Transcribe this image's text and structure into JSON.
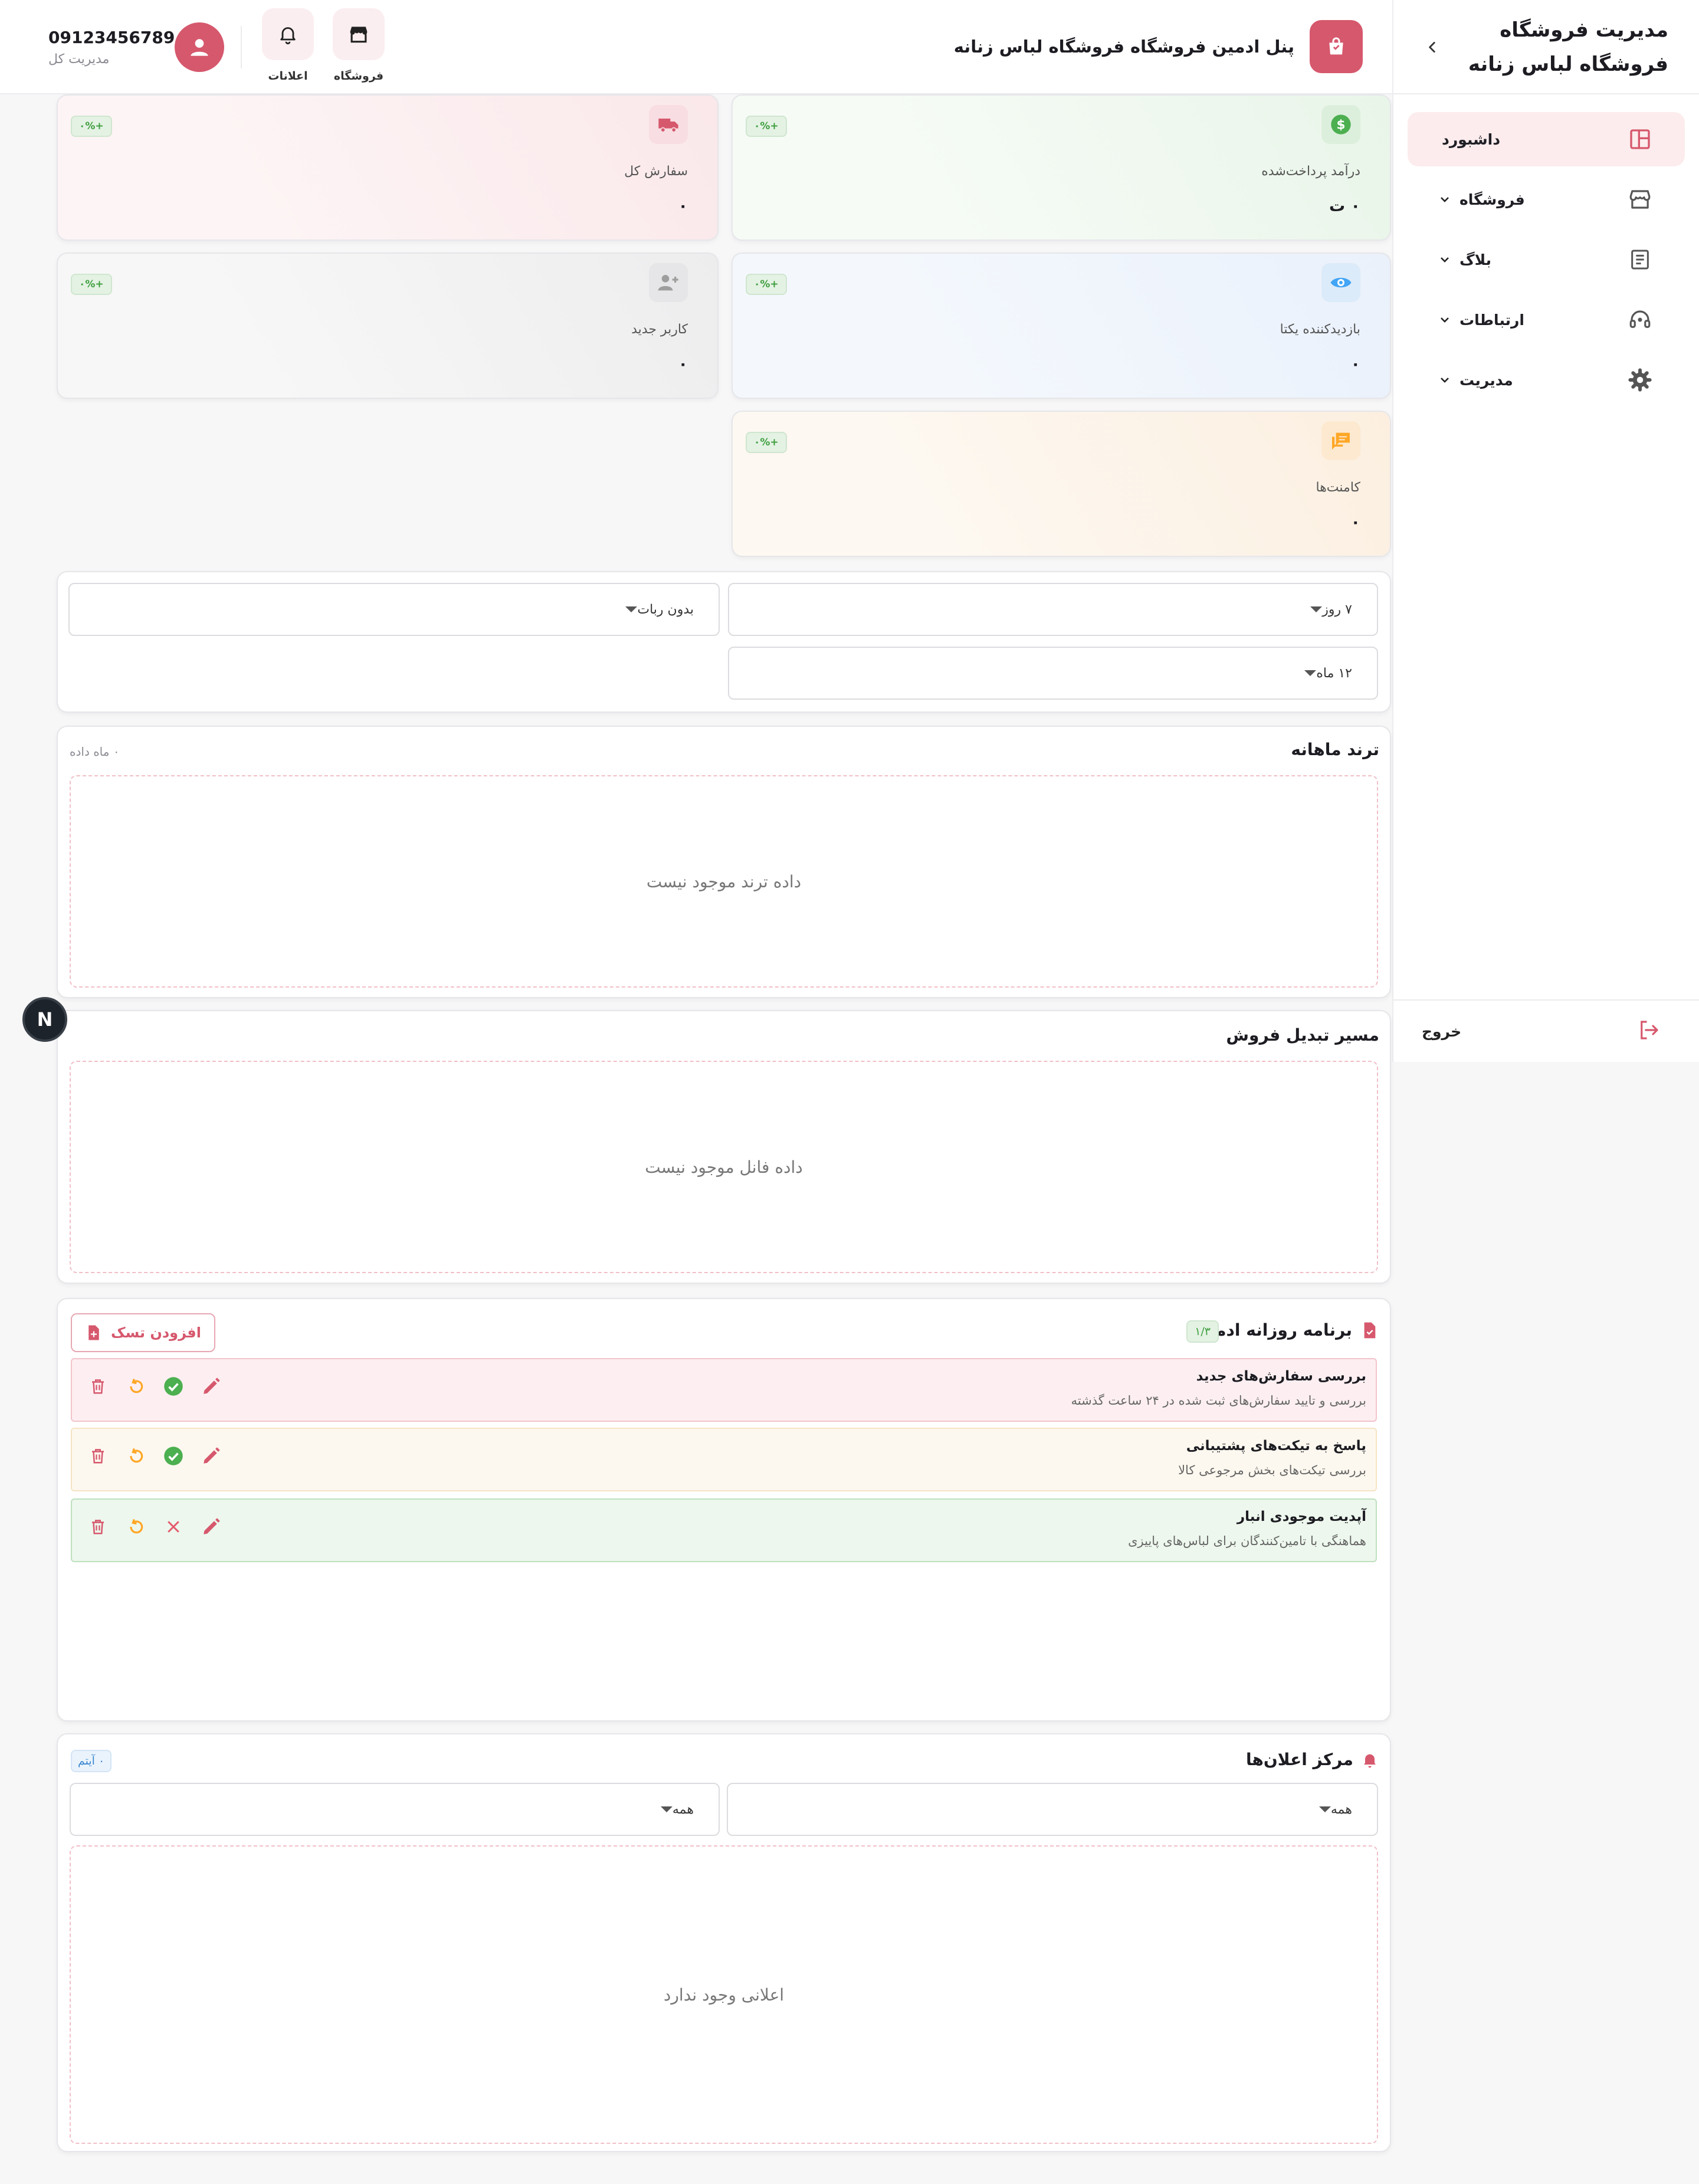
{
  "sidebar": {
    "title": "مدیریت فروشگاه فروشگاه لباس زنانه",
    "items": [
      {
        "label": "داشبورد",
        "active": true
      },
      {
        "label": "فروشگاه"
      },
      {
        "label": "بلاگ"
      },
      {
        "label": "ارتباطات"
      },
      {
        "label": "مدیریت"
      }
    ],
    "logout": "خروج"
  },
  "header": {
    "title": "پنل ادمین فروشگاه فروشگاه لباس زنانه",
    "shop_label": "فروشگاه",
    "notifications_label": "اعلانات",
    "user_phone": "09123456789",
    "user_role": "مدیریت کل"
  },
  "stats": [
    {
      "label": "درآمد پرداخت‌شده",
      "value": "۰ ت",
      "badge": "+۰%",
      "icon": "dollar-icon",
      "color": "#4caf50"
    },
    {
      "label": "سفارش کل",
      "value": "۰",
      "badge": "+۰%",
      "icon": "truck-icon",
      "color": "#d6586d"
    },
    {
      "label": "بازدیدکننده یکتا",
      "value": "۰",
      "badge": "+۰%",
      "icon": "eye-icon",
      "color": "#42a5f5"
    },
    {
      "label": "کاربر جدید",
      "value": "۰",
      "badge": "+۰%",
      "icon": "user-add-icon",
      "color": "#9e9e9e"
    },
    {
      "label": "کامنت‌ها",
      "value": "۰",
      "badge": "+۰%",
      "icon": "chat-icon",
      "color": "#ffa726"
    }
  ],
  "filters": {
    "range_days": "۷ روز",
    "bots": "بدون ربات",
    "range_months": "۱۲ ماه"
  },
  "trend": {
    "title": "ترند ماهانه",
    "note": "۰ ماه داده",
    "empty": "داده ترند موجود نیست"
  },
  "funnel": {
    "title": "مسیر تبدیل فروش",
    "empty": "داده فانل موجود نیست"
  },
  "tasks": {
    "title": "برنامه روزانه ادمین",
    "count": "۱/۳",
    "add_label": "افزودن تسک",
    "items": [
      {
        "title": "بررسی سفارش‌های جدید",
        "desc": "بررسی و تایید سفارش‌های ثبت شده در ۲۴ ساعت گذشته",
        "status": "done"
      },
      {
        "title": "پاسخ به تیکت‌های پشتیبانی",
        "desc": "بررسی تیکت‌های بخش مرجوعی کالا",
        "status": "done"
      },
      {
        "title": "آپدیت موجودی انبار",
        "desc": "هماهنگی با تامین‌کنندگان برای لباس‌های پاییزی",
        "status": "open"
      }
    ]
  },
  "notifications": {
    "title": "مرکز اعلان‌ها",
    "count": "۰ آیتم",
    "filter_a": "همه",
    "filter_b": "همه",
    "empty": "اعلانی وجود ندارد"
  },
  "fab_label": "N",
  "colors": {
    "accent": "#d6586d",
    "success": "#4caf50",
    "warning": "#ffa726"
  }
}
